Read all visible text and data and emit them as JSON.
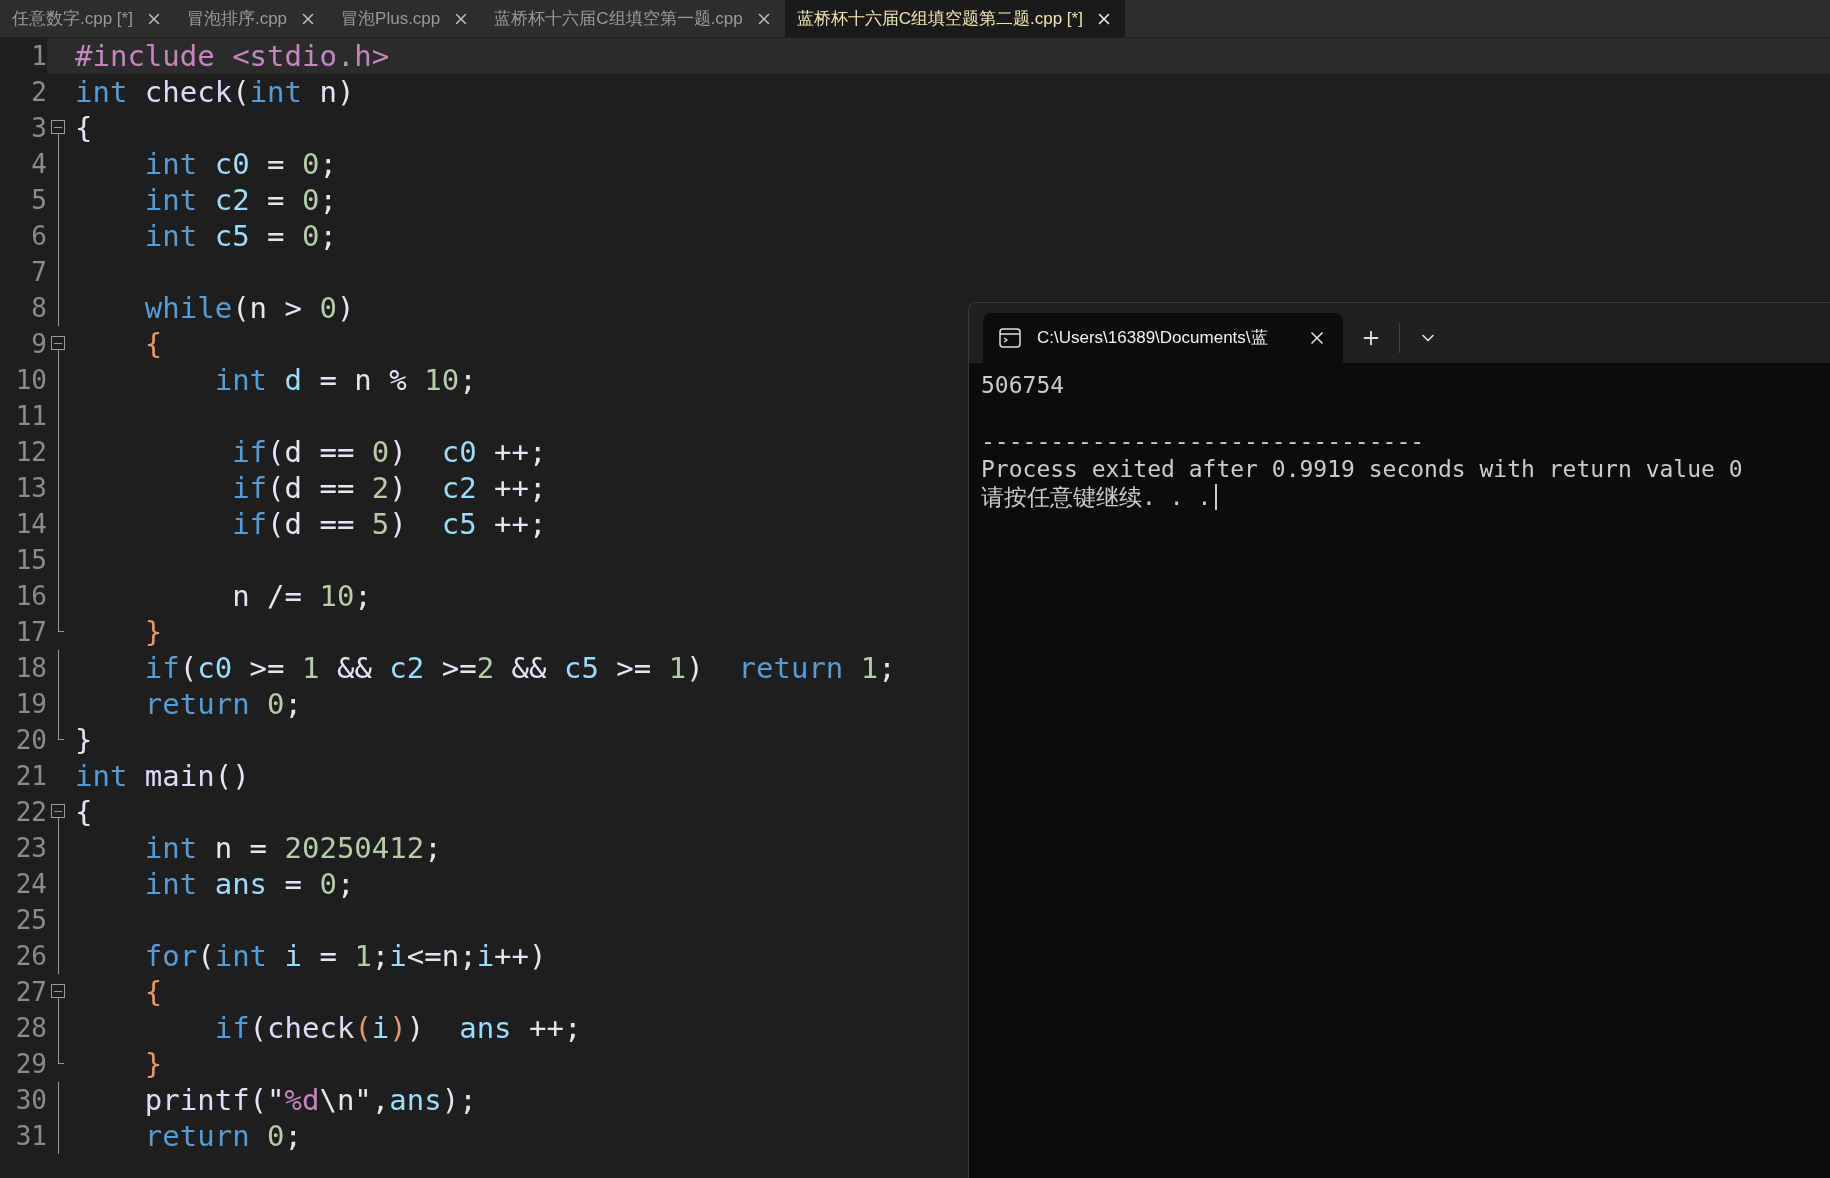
{
  "editor_tabs": [
    {
      "label": "任意数字.cpp [*]",
      "selected": false
    },
    {
      "label": "冒泡排序.cpp",
      "selected": false
    },
    {
      "label": "冒泡Plus.cpp",
      "selected": false
    },
    {
      "label": "蓝桥杯十六届C组填空第一题.cpp",
      "selected": false
    },
    {
      "label": "蓝桥杯十六届C组填空题第二题.cpp [*]",
      "selected": true
    }
  ],
  "code_lines": [
    {
      "number": "1",
      "kind": "plain",
      "current": true,
      "tokens": [
        {
          "kind": "preprocessor",
          "text": "#include <stdio.h>"
        }
      ]
    },
    {
      "number": "2",
      "kind": "plain",
      "current": false,
      "tokens": [
        {
          "kind": "keyword",
          "text": "int"
        },
        {
          "kind": "function",
          "text": " check"
        },
        {
          "kind": "plain",
          "text": "("
        },
        {
          "kind": "keyword",
          "text": "int"
        },
        {
          "kind": "plain",
          "text": " n)"
        }
      ]
    },
    {
      "number": "3",
      "kind": "fold-start",
      "current": false,
      "tokens": [
        {
          "kind": "plain",
          "text": "{"
        }
      ]
    },
    {
      "number": "4",
      "kind": "plain",
      "current": false,
      "tokens": [
        {
          "kind": "keyword",
          "text": "    int"
        },
        {
          "kind": "variable",
          "text": " c0"
        },
        {
          "kind": "plain",
          "text": " = "
        },
        {
          "kind": "number",
          "text": "0"
        },
        {
          "kind": "plain",
          "text": ";"
        }
      ]
    },
    {
      "number": "5",
      "kind": "plain",
      "current": false,
      "tokens": [
        {
          "kind": "keyword",
          "text": "    int"
        },
        {
          "kind": "variable",
          "text": " c2"
        },
        {
          "kind": "plain",
          "text": " = "
        },
        {
          "kind": "number",
          "text": "0"
        },
        {
          "kind": "plain",
          "text": ";"
        }
      ]
    },
    {
      "number": "6",
      "kind": "plain",
      "current": false,
      "tokens": [
        {
          "kind": "keyword",
          "text": "    int"
        },
        {
          "kind": "variable",
          "text": " c5"
        },
        {
          "kind": "plain",
          "text": " = "
        },
        {
          "kind": "number",
          "text": "0"
        },
        {
          "kind": "plain",
          "text": ";"
        }
      ]
    },
    {
      "number": "7",
      "kind": "plain",
      "current": false
    },
    {
      "number": "8",
      "kind": "plain",
      "current": false,
      "tokens": [
        {
          "kind": "keyword",
          "text": "    while"
        },
        {
          "kind": "plain",
          "text": "(n > "
        },
        {
          "kind": "number",
          "text": "0"
        },
        {
          "kind": "plain",
          "text": ")"
        }
      ]
    },
    {
      "number": "9",
      "kind": "fold-start",
      "current": false,
      "tokens": [
        {
          "kind": "bracket",
          "text": "    {"
        }
      ]
    },
    {
      "number": "10",
      "kind": "plain",
      "current": false,
      "tokens": [
        {
          "kind": "keyword",
          "text": "        int"
        },
        {
          "kind": "variable",
          "text": " d"
        },
        {
          "kind": "plain",
          "text": " = n % "
        },
        {
          "kind": "number",
          "text": "10"
        },
        {
          "kind": "plain",
          "text": ";"
        }
      ]
    },
    {
      "number": "11",
      "kind": "plain",
      "current": false
    },
    {
      "number": "12",
      "kind": "plain",
      "current": false,
      "tokens": [
        {
          "kind": "keyword",
          "text": "         if"
        },
        {
          "kind": "plain",
          "text": "(d == "
        },
        {
          "kind": "number",
          "text": "0"
        },
        {
          "kind": "plain",
          "text": ")  "
        },
        {
          "kind": "variable",
          "text": "c0"
        },
        {
          "kind": "plain",
          "text": " ++;"
        }
      ]
    },
    {
      "number": "13",
      "kind": "plain",
      "current": false,
      "tokens": [
        {
          "kind": "keyword",
          "text": "         if"
        },
        {
          "kind": "plain",
          "text": "(d == "
        },
        {
          "kind": "number",
          "text": "2"
        },
        {
          "kind": "plain",
          "text": ")  "
        },
        {
          "kind": "variable",
          "text": "c2"
        },
        {
          "kind": "plain",
          "text": " ++;"
        }
      ]
    },
    {
      "number": "14",
      "kind": "plain",
      "current": false,
      "tokens": [
        {
          "kind": "keyword",
          "text": "         if"
        },
        {
          "kind": "plain",
          "text": "(d == "
        },
        {
          "kind": "number",
          "text": "5"
        },
        {
          "kind": "plain",
          "text": ")  "
        },
        {
          "kind": "variable",
          "text": "c5"
        },
        {
          "kind": "plain",
          "text": " ++;"
        }
      ]
    },
    {
      "number": "15",
      "kind": "plain",
      "current": false
    },
    {
      "number": "16",
      "kind": "plain",
      "current": false,
      "tokens": [
        {
          "kind": "plain",
          "text": "         n /= "
        },
        {
          "kind": "number",
          "text": "10"
        },
        {
          "kind": "plain",
          "text": ";"
        }
      ]
    },
    {
      "number": "17",
      "kind": "fold-end",
      "current": false,
      "tokens": [
        {
          "kind": "bracket",
          "text": "    }"
        }
      ]
    },
    {
      "number": "18",
      "kind": "plain",
      "current": false,
      "tokens": [
        {
          "kind": "keyword",
          "text": "    if"
        },
        {
          "kind": "plain",
          "text": "("
        },
        {
          "kind": "variable",
          "text": "c0"
        },
        {
          "kind": "plain",
          "text": " >= "
        },
        {
          "kind": "number",
          "text": "1"
        },
        {
          "kind": "plain",
          "text": " && "
        },
        {
          "kind": "variable",
          "text": "c2"
        },
        {
          "kind": "plain",
          "text": " >="
        },
        {
          "kind": "number",
          "text": "2"
        },
        {
          "kind": "plain",
          "text": " && "
        },
        {
          "kind": "variable",
          "text": "c5"
        },
        {
          "kind": "plain",
          "text": " >= "
        },
        {
          "kind": "number",
          "text": "1"
        },
        {
          "kind": "plain",
          "text": ")  "
        },
        {
          "kind": "keyword",
          "text": "return"
        },
        {
          "kind": "number",
          "text": " 1"
        },
        {
          "kind": "plain",
          "text": ";"
        }
      ]
    },
    {
      "number": "19",
      "kind": "plain",
      "current": false,
      "tokens": [
        {
          "kind": "keyword",
          "text": "    return"
        },
        {
          "kind": "number",
          "text": " 0"
        },
        {
          "kind": "plain",
          "text": ";"
        }
      ]
    },
    {
      "number": "20",
      "kind": "fold-end",
      "current": false,
      "tokens": [
        {
          "kind": "plain",
          "text": "}"
        }
      ]
    },
    {
      "number": "21",
      "kind": "plain",
      "current": false,
      "tokens": [
        {
          "kind": "keyword",
          "text": "int"
        },
        {
          "kind": "function",
          "text": " main"
        },
        {
          "kind": "plain",
          "text": "()"
        }
      ]
    },
    {
      "number": "22",
      "kind": "fold-start",
      "current": false,
      "tokens": [
        {
          "kind": "plain",
          "text": "{"
        }
      ]
    },
    {
      "number": "23",
      "kind": "plain",
      "current": false,
      "tokens": [
        {
          "kind": "keyword",
          "text": "    int"
        },
        {
          "kind": "plain",
          "text": " n = "
        },
        {
          "kind": "number",
          "text": "20250412"
        },
        {
          "kind": "plain",
          "text": ";"
        }
      ]
    },
    {
      "number": "24",
      "kind": "plain",
      "current": false,
      "tokens": [
        {
          "kind": "keyword",
          "text": "    int"
        },
        {
          "kind": "variable",
          "text": " ans"
        },
        {
          "kind": "plain",
          "text": " = "
        },
        {
          "kind": "number",
          "text": "0"
        },
        {
          "kind": "plain",
          "text": ";"
        }
      ]
    },
    {
      "number": "25",
      "kind": "plain",
      "current": false
    },
    {
      "number": "26",
      "kind": "plain",
      "current": false,
      "tokens": [
        {
          "kind": "keyword",
          "text": "    for"
        },
        {
          "kind": "plain",
          "text": "("
        },
        {
          "kind": "keyword",
          "text": "int"
        },
        {
          "kind": "variable",
          "text": " i"
        },
        {
          "kind": "plain",
          "text": " = "
        },
        {
          "kind": "number",
          "text": "1"
        },
        {
          "kind": "plain",
          "text": ";"
        },
        {
          "kind": "variable",
          "text": "i"
        },
        {
          "kind": "plain",
          "text": "<=n;"
        },
        {
          "kind": "variable",
          "text": "i"
        },
        {
          "kind": "plain",
          "text": "++)"
        }
      ]
    },
    {
      "number": "27",
      "kind": "fold-start",
      "current": false,
      "tokens": [
        {
          "kind": "bracket",
          "text": "    {"
        }
      ]
    },
    {
      "number": "28",
      "kind": "plain",
      "current": false,
      "tokens": [
        {
          "kind": "keyword",
          "text": "        if"
        },
        {
          "kind": "plain",
          "text": "("
        },
        {
          "kind": "function",
          "text": "check"
        },
        {
          "kind": "bracket",
          "text": "("
        },
        {
          "kind": "variable",
          "text": "i"
        },
        {
          "kind": "bracket",
          "text": ")"
        },
        {
          "kind": "plain",
          "text": ")  "
        },
        {
          "kind": "variable",
          "text": "ans"
        },
        {
          "kind": "plain",
          "text": " ++;"
        }
      ]
    },
    {
      "number": "29",
      "kind": "fold-end",
      "current": false,
      "tokens": [
        {
          "kind": "bracket",
          "text": "    }"
        }
      ]
    },
    {
      "number": "30",
      "kind": "plain",
      "current": false,
      "tokens": [
        {
          "kind": "function",
          "text": "    printf"
        },
        {
          "kind": "plain",
          "text": "(\""
        },
        {
          "kind": "format",
          "text": "%d"
        },
        {
          "kind": "plain",
          "text": "\\n\","
        },
        {
          "kind": "variable",
          "text": "ans"
        },
        {
          "kind": "plain",
          "text": ");"
        }
      ]
    },
    {
      "number": "31",
      "kind": "plain",
      "current": false,
      "tokens": [
        {
          "kind": "keyword",
          "text": "    return"
        },
        {
          "kind": "number",
          "text": " 0"
        },
        {
          "kind": "plain",
          "text": ";"
        }
      ]
    }
  ],
  "terminal": {
    "tab_title": "C:\\Users\\16389\\Documents\\蓝",
    "lines": [
      {
        "kind": "output",
        "text": "506754"
      },
      {
        "kind": "rule",
        "text": "--------------------------------"
      },
      {
        "kind": "status",
        "text": "Process exited after 0.9919 seconds with return value 0"
      },
      {
        "kind": "prompt",
        "text": "请按任意键继续. . ."
      }
    ]
  }
}
